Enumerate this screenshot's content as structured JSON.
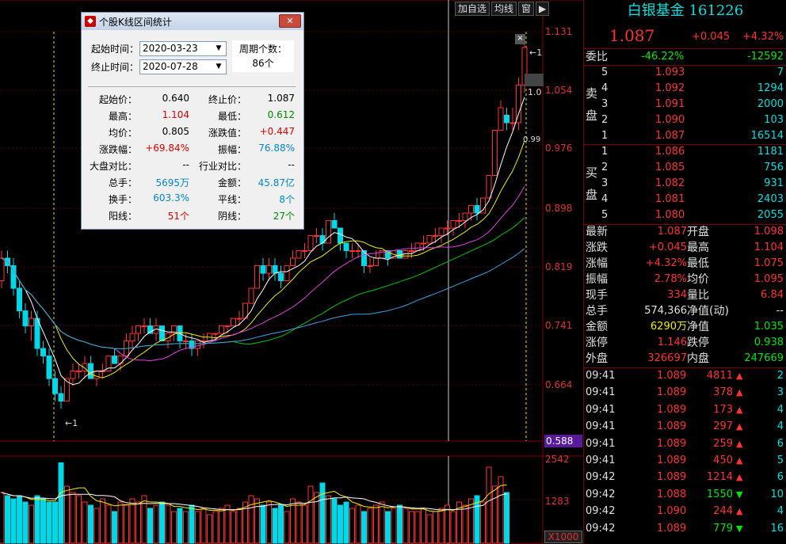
{
  "toolbar": {
    "btn1": "加自选",
    "btn2": "均线",
    "btn3": "窗",
    "btn4": "▶"
  },
  "price_axis": [
    "1.131",
    "1.054",
    "0.976",
    "0.898",
    "0.819",
    "0.741",
    "0.664"
  ],
  "price_axis_current": "0.588",
  "volume_axis": [
    "2542",
    "1283"
  ],
  "volume_unit": "X1000",
  "chart_marks": {
    "low_marker": "1",
    "high_marker": "1",
    "mid_tag1": "1.0",
    "mid_tag2": "0.99"
  },
  "chart_data": {
    "type": "candlestick",
    "ylim": [
      0.588,
      1.131
    ],
    "candles": [
      [
        0.8,
        0.84,
        0.79,
        0.83
      ],
      [
        0.83,
        0.84,
        0.81,
        0.82
      ],
      [
        0.82,
        0.83,
        0.78,
        0.79
      ],
      [
        0.79,
        0.8,
        0.75,
        0.76
      ],
      [
        0.76,
        0.77,
        0.73,
        0.74
      ],
      [
        0.74,
        0.76,
        0.72,
        0.75
      ],
      [
        0.75,
        0.76,
        0.7,
        0.71
      ],
      [
        0.71,
        0.72,
        0.69,
        0.7
      ],
      [
        0.7,
        0.71,
        0.66,
        0.67
      ],
      [
        0.67,
        0.68,
        0.64,
        0.65
      ],
      [
        0.65,
        0.66,
        0.63,
        0.64
      ],
      [
        0.64,
        0.67,
        0.64,
        0.67
      ],
      [
        0.67,
        0.69,
        0.66,
        0.68
      ],
      [
        0.68,
        0.69,
        0.67,
        0.68
      ],
      [
        0.68,
        0.7,
        0.67,
        0.69
      ],
      [
        0.69,
        0.7,
        0.67,
        0.67
      ],
      [
        0.67,
        0.68,
        0.66,
        0.68
      ],
      [
        0.68,
        0.69,
        0.67,
        0.68
      ],
      [
        0.68,
        0.7,
        0.68,
        0.7
      ],
      [
        0.7,
        0.71,
        0.69,
        0.69
      ],
      [
        0.69,
        0.7,
        0.68,
        0.7
      ],
      [
        0.7,
        0.73,
        0.7,
        0.72
      ],
      [
        0.72,
        0.74,
        0.71,
        0.73
      ],
      [
        0.73,
        0.74,
        0.72,
        0.74
      ],
      [
        0.74,
        0.75,
        0.73,
        0.74
      ],
      [
        0.74,
        0.75,
        0.73,
        0.73
      ],
      [
        0.73,
        0.75,
        0.72,
        0.74
      ],
      [
        0.74,
        0.74,
        0.72,
        0.72
      ],
      [
        0.72,
        0.73,
        0.71,
        0.73
      ],
      [
        0.73,
        0.74,
        0.72,
        0.74
      ],
      [
        0.74,
        0.74,
        0.71,
        0.72
      ],
      [
        0.72,
        0.73,
        0.71,
        0.72
      ],
      [
        0.72,
        0.73,
        0.7,
        0.71
      ],
      [
        0.71,
        0.72,
        0.7,
        0.72
      ],
      [
        0.72,
        0.73,
        0.71,
        0.72
      ],
      [
        0.72,
        0.73,
        0.72,
        0.73
      ],
      [
        0.73,
        0.73,
        0.72,
        0.73
      ],
      [
        0.73,
        0.74,
        0.73,
        0.74
      ],
      [
        0.74,
        0.74,
        0.73,
        0.74
      ],
      [
        0.74,
        0.75,
        0.74,
        0.75
      ],
      [
        0.75,
        0.76,
        0.74,
        0.75
      ],
      [
        0.75,
        0.77,
        0.75,
        0.77
      ],
      [
        0.77,
        0.79,
        0.77,
        0.79
      ],
      [
        0.79,
        0.82,
        0.79,
        0.82
      ],
      [
        0.82,
        0.83,
        0.8,
        0.81
      ],
      [
        0.81,
        0.83,
        0.8,
        0.82
      ],
      [
        0.82,
        0.83,
        0.8,
        0.81
      ],
      [
        0.81,
        0.82,
        0.79,
        0.8
      ],
      [
        0.8,
        0.82,
        0.8,
        0.82
      ],
      [
        0.82,
        0.84,
        0.82,
        0.83
      ],
      [
        0.83,
        0.84,
        0.83,
        0.84
      ],
      [
        0.84,
        0.85,
        0.83,
        0.84
      ],
      [
        0.84,
        0.86,
        0.84,
        0.86
      ],
      [
        0.86,
        0.87,
        0.85,
        0.86
      ],
      [
        0.86,
        0.87,
        0.84,
        0.85
      ],
      [
        0.85,
        0.88,
        0.85,
        0.88
      ],
      [
        0.88,
        0.89,
        0.87,
        0.87
      ],
      [
        0.87,
        0.87,
        0.84,
        0.85
      ],
      [
        0.85,
        0.85,
        0.83,
        0.84
      ],
      [
        0.84,
        0.85,
        0.83,
        0.84
      ],
      [
        0.84,
        0.85,
        0.83,
        0.84
      ],
      [
        0.84,
        0.84,
        0.81,
        0.82
      ],
      [
        0.82,
        0.83,
        0.81,
        0.82
      ],
      [
        0.82,
        0.84,
        0.82,
        0.83
      ],
      [
        0.83,
        0.84,
        0.83,
        0.84
      ],
      [
        0.84,
        0.84,
        0.82,
        0.83
      ],
      [
        0.83,
        0.84,
        0.83,
        0.84
      ],
      [
        0.84,
        0.84,
        0.83,
        0.83
      ],
      [
        0.83,
        0.84,
        0.83,
        0.84
      ],
      [
        0.84,
        0.85,
        0.83,
        0.84
      ],
      [
        0.84,
        0.85,
        0.84,
        0.85
      ],
      [
        0.85,
        0.86,
        0.84,
        0.85
      ],
      [
        0.85,
        0.86,
        0.85,
        0.86
      ],
      [
        0.86,
        0.87,
        0.85,
        0.86
      ],
      [
        0.86,
        0.87,
        0.85,
        0.87
      ],
      [
        0.87,
        0.88,
        0.86,
        0.87
      ],
      [
        0.87,
        0.88,
        0.86,
        0.88
      ],
      [
        0.88,
        0.89,
        0.87,
        0.88
      ],
      [
        0.88,
        0.89,
        0.87,
        0.89
      ],
      [
        0.89,
        0.9,
        0.88,
        0.9
      ],
      [
        0.9,
        0.91,
        0.88,
        0.89
      ],
      [
        0.89,
        0.91,
        0.89,
        0.91
      ],
      [
        0.91,
        0.94,
        0.91,
        0.94
      ],
      [
        0.94,
        1.0,
        0.94,
        1.0
      ],
      [
        1.0,
        1.04,
        1.0,
        1.03
      ],
      [
        1.02,
        1.03,
        1.0,
        1.01
      ],
      [
        1.01,
        1.03,
        1.0,
        1.01
      ],
      [
        1.01,
        1.07,
        1.0,
        1.06
      ],
      [
        1.06,
        1.12,
        1.05,
        1.11
      ]
    ],
    "volume": [
      1.6,
      1.5,
      1.4,
      1.5,
      1.3,
      1.2,
      1.5,
      1.4,
      1.3,
      1.3,
      2.54,
      1.8,
      1.6,
      1.5,
      1.3,
      1.2,
      1.1,
      1.4,
      1.2,
      1.0,
      1.3,
      1.2,
      1.4,
      1.3,
      1.5,
      1.1,
      1.2,
      1.3,
      1.2,
      1.0,
      1.1,
      1.0,
      1.2,
      1.0,
      1.1,
      0.9,
      1.0,
      1.1,
      1.2,
      1.0,
      1.1,
      1.3,
      1.5,
      1.4,
      1.2,
      1.3,
      1.1,
      1.2,
      1.0,
      1.4,
      1.3,
      1.2,
      1.8,
      1.6,
      1.9,
      1.5,
      1.4,
      1.2,
      1.3,
      1.1,
      1.2,
      1.0,
      1.1,
      1.2,
      1.3,
      1.0,
      1.1,
      1.2,
      1.1,
      1.0,
      1.0,
      1.1,
      0.9,
      1.0,
      1.1,
      1.2,
      1.0,
      1.3,
      1.2,
      1.4,
      1.5,
      1.3,
      2.4,
      1.8,
      2.1,
      1.6
    ]
  },
  "dialog": {
    "title": "个股K线区间统计",
    "start_label": "起始时间：",
    "start_value": "2020-03-23",
    "end_label": "终止时间：",
    "end_value": "2020-07-28",
    "cycle_label": "周期个数：",
    "cycle_value": "86个",
    "stats": [
      {
        "l1": "起始价：",
        "v1": "0.640",
        "c1": "#000",
        "l2": "终止价：",
        "v2": "1.087",
        "c2": "#000"
      },
      {
        "l1": "最高：",
        "v1": "1.104",
        "c1": "#e00000",
        "l2": "最低：",
        "v2": "0.612",
        "c2": "#008800"
      },
      {
        "l1": "均价：",
        "v1": "0.805",
        "c1": "#000",
        "l2": "涨跌值：",
        "v2": "+0.447",
        "c2": "#e00000"
      },
      {
        "l1": "涨跌幅：",
        "v1": "+69.84%",
        "c1": "#e00000",
        "l2": "振幅：",
        "v2": "76.88%",
        "c2": "#0088cc"
      },
      {
        "l1": "大盘对比：",
        "v1": "--",
        "c1": "#000",
        "l2": "行业对比：",
        "v2": "--",
        "c2": "#000"
      },
      {
        "l1": "总手：",
        "v1": "5695万",
        "c1": "#0088cc",
        "l2": "金额：",
        "v2": "45.87亿",
        "c2": "#0088cc"
      },
      {
        "l1": "换手：",
        "v1": "603.3%",
        "c1": "#0088cc",
        "l2": "平线：",
        "v2": "8个",
        "c2": "#0088cc"
      },
      {
        "l1": "阳线：",
        "v1": "51个",
        "c1": "#e00000",
        "l2": "阴线：",
        "v2": "27个",
        "c2": "#008800"
      }
    ]
  },
  "quote": {
    "name": "白银基金",
    "code": "161226",
    "price": "1.087",
    "change": "+0.045",
    "pct": "+4.32%",
    "weibi_label": "委比",
    "weibi_pct": "-46.22%",
    "weibi_val": "-12592",
    "sell_label": "卖盘",
    "buy_label": "买盘",
    "asks": [
      {
        "n": "5",
        "p": "1.093",
        "v": "7"
      },
      {
        "n": "4",
        "p": "1.092",
        "v": "1294"
      },
      {
        "n": "3",
        "p": "1.091",
        "v": "2000"
      },
      {
        "n": "2",
        "p": "1.090",
        "v": "103"
      },
      {
        "n": "1",
        "p": "1.087",
        "v": "16514"
      }
    ],
    "bids": [
      {
        "n": "1",
        "p": "1.086",
        "v": "1181"
      },
      {
        "n": "2",
        "p": "1.085",
        "v": "756"
      },
      {
        "n": "3",
        "p": "1.082",
        "v": "931"
      },
      {
        "n": "4",
        "p": "1.081",
        "v": "2403"
      },
      {
        "n": "5",
        "p": "1.080",
        "v": "2055"
      }
    ],
    "info": [
      {
        "l1": "最新",
        "v1": "1.087",
        "c1": "red",
        "l2": "开盘",
        "v2": "1.098",
        "c2": "red"
      },
      {
        "l1": "涨跌",
        "v1": "+0.045",
        "c1": "red",
        "l2": "最高",
        "v2": "1.104",
        "c2": "red"
      },
      {
        "l1": "涨幅",
        "v1": "+4.32%",
        "c1": "red",
        "l2": "最低",
        "v2": "1.075",
        "c2": "red"
      },
      {
        "l1": "振幅",
        "v1": "2.78%",
        "c1": "red",
        "l2": "均价",
        "v2": "1.095",
        "c2": "red"
      },
      {
        "l1": "现手",
        "v1": "334",
        "c1": "red",
        "l2": "量比",
        "v2": "6.84",
        "c2": "red"
      },
      {
        "l1": "总手",
        "v1": "574,366",
        "c1": "wht",
        "l2": "净值(动)",
        "v2": "--",
        "c2": "wht"
      },
      {
        "l1": "金额",
        "v1": "6290万",
        "c1": "yel",
        "l2": "净值",
        "v2": "1.035",
        "c2": "grn"
      },
      {
        "l1": "涨停",
        "v1": "1.146",
        "c1": "red",
        "l2": "跌停",
        "v2": "0.938",
        "c2": "grn"
      },
      {
        "l1": "外盘",
        "v1": "326697",
        "c1": "red",
        "l2": "内盘",
        "v2": "247669",
        "c2": "grn"
      }
    ],
    "ticks": [
      {
        "t": "09:41",
        "p": "1.089",
        "v": "4811",
        "d": "up",
        "n": "2"
      },
      {
        "t": "09:41",
        "p": "1.089",
        "v": "378",
        "d": "up",
        "n": "3"
      },
      {
        "t": "09:41",
        "p": "1.089",
        "v": "173",
        "d": "up",
        "n": "4"
      },
      {
        "t": "09:41",
        "p": "1.089",
        "v": "297",
        "d": "up",
        "n": "4"
      },
      {
        "t": "09:41",
        "p": "1.089",
        "v": "259",
        "d": "up",
        "n": "6"
      },
      {
        "t": "09:41",
        "p": "1.089",
        "v": "450",
        "d": "up",
        "n": "5"
      },
      {
        "t": "09:42",
        "p": "1.089",
        "v": "1214",
        "d": "up",
        "n": "6"
      },
      {
        "t": "09:42",
        "p": "1.088",
        "v": "1550",
        "d": "down",
        "n": "10"
      },
      {
        "t": "09:42",
        "p": "1.090",
        "v": "244",
        "d": "up",
        "n": "4"
      },
      {
        "t": "09:42",
        "p": "1.089",
        "v": "779",
        "d": "down",
        "n": "16"
      }
    ]
  }
}
